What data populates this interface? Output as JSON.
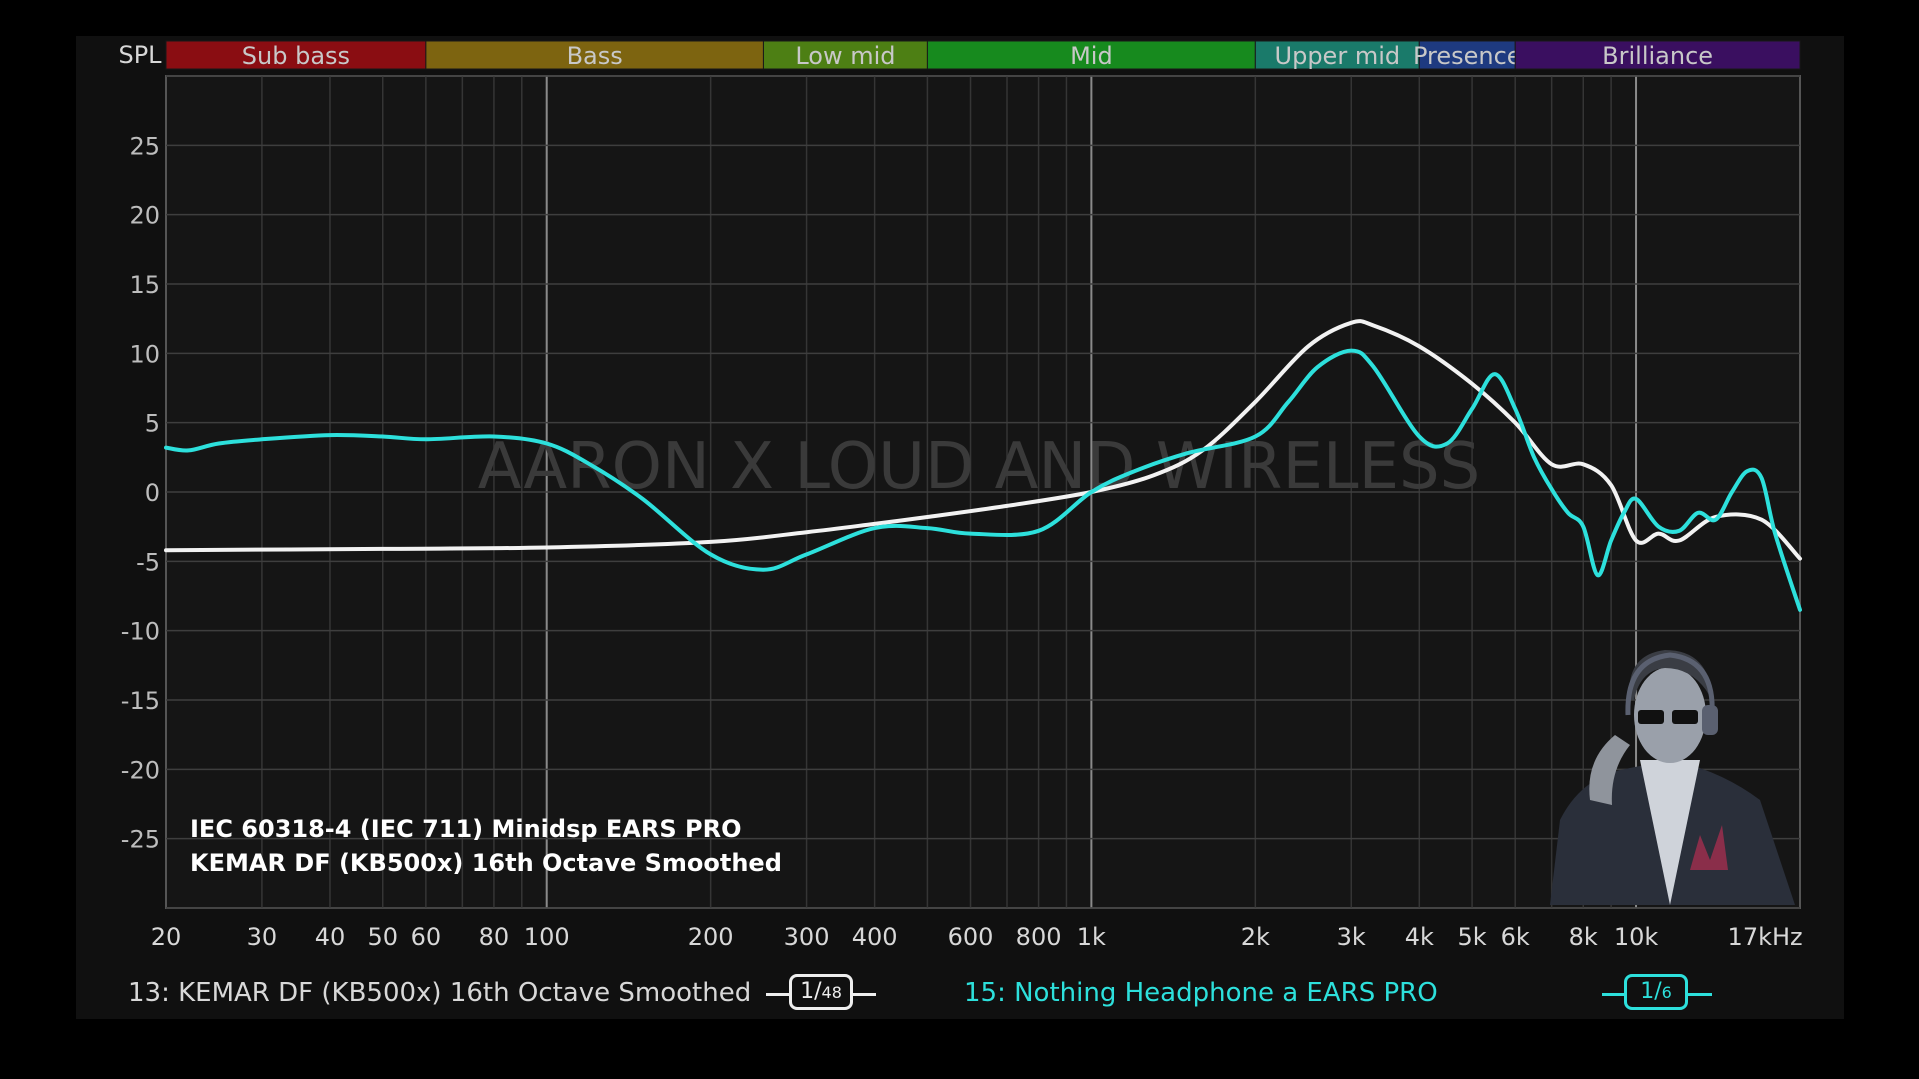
{
  "chart_data": {
    "type": "line",
    "title": "",
    "ylabel": "SPL",
    "xunit": "kHz",
    "x_scale": "log",
    "xlim": [
      20,
      20000
    ],
    "ylim": [
      -30,
      30
    ],
    "grid": true,
    "y_ticks": [
      25,
      20,
      15,
      10,
      5,
      0,
      -5,
      -10,
      -15,
      -20,
      -25
    ],
    "x_ticks": [
      {
        "value": 20,
        "label": "20"
      },
      {
        "value": 30,
        "label": "30"
      },
      {
        "value": 40,
        "label": "40"
      },
      {
        "value": 50,
        "label": "50"
      },
      {
        "value": 60,
        "label": "60"
      },
      {
        "value": 80,
        "label": "80"
      },
      {
        "value": 100,
        "label": "100"
      },
      {
        "value": 200,
        "label": "200"
      },
      {
        "value": 300,
        "label": "300"
      },
      {
        "value": 400,
        "label": "400"
      },
      {
        "value": 600,
        "label": "600"
      },
      {
        "value": 800,
        "label": "800"
      },
      {
        "value": 1000,
        "label": "1k"
      },
      {
        "value": 2000,
        "label": "2k"
      },
      {
        "value": 3000,
        "label": "3k"
      },
      {
        "value": 4000,
        "label": "4k"
      },
      {
        "value": 5000,
        "label": "5k"
      },
      {
        "value": 6000,
        "label": "6k"
      },
      {
        "value": 8000,
        "label": "8k"
      },
      {
        "value": 10000,
        "label": "10k"
      },
      {
        "value": 17000,
        "label": "17kHz"
      }
    ],
    "bands": [
      {
        "name": "Sub bass",
        "from": 20,
        "to": 60,
        "color": "#8a0d12"
      },
      {
        "name": "Bass",
        "from": 60,
        "to": 250,
        "color": "#7d6410"
      },
      {
        "name": "Low mid",
        "from": 250,
        "to": 500,
        "color": "#4d7f14"
      },
      {
        "name": "Mid",
        "from": 500,
        "to": 2000,
        "color": "#178a1e"
      },
      {
        "name": "Upper mid",
        "from": 2000,
        "to": 4000,
        "color": "#1a7a6a"
      },
      {
        "name": "Presence",
        "from": 4000,
        "to": 6000,
        "color": "#1e3a80"
      },
      {
        "name": "Brilliance",
        "from": 6000,
        "to": 20000,
        "color": "#3a0f60"
      }
    ],
    "series": [
      {
        "name": "13: KEMAR DF (KB500x) 16th Octave Smoothed",
        "color": "#f2f2f2",
        "smoothing": "1/48",
        "x": [
          20,
          50,
          100,
          200,
          300,
          400,
          500,
          700,
          1000,
          1300,
          1600,
          2000,
          2500,
          3000,
          3300,
          4000,
          5000,
          6000,
          7000,
          8000,
          9000,
          10000,
          11000,
          12000,
          14000,
          17000,
          20000
        ],
        "y": [
          -4.2,
          -4.1,
          -4.0,
          -3.6,
          -2.9,
          -2.3,
          -1.8,
          -1.0,
          0.0,
          1.2,
          3.0,
          6.5,
          10.5,
          12.2,
          12.0,
          10.5,
          7.8,
          5.0,
          2.0,
          2.0,
          0.5,
          -3.5,
          -3.0,
          -3.5,
          -1.8,
          -2.0,
          -4.8
        ]
      },
      {
        "name": "15: Nothing Headphone a EARS PRO",
        "color": "#2de0dc",
        "smoothing": "1/6",
        "x": [
          20,
          22,
          25,
          30,
          40,
          50,
          60,
          80,
          100,
          120,
          150,
          200,
          250,
          300,
          400,
          500,
          600,
          800,
          1000,
          1200,
          1500,
          2000,
          2300,
          2600,
          3000,
          3300,
          4000,
          4500,
          5000,
          5500,
          6000,
          6500,
          7000,
          7500,
          8000,
          8500,
          9000,
          9500,
          10000,
          11000,
          12000,
          13000,
          14000,
          15000,
          16000,
          17000,
          18000,
          20000
        ],
        "y": [
          3.2,
          3.0,
          3.5,
          3.8,
          4.1,
          4.0,
          3.8,
          4.0,
          3.5,
          2.0,
          -0.5,
          -4.5,
          -5.6,
          -4.5,
          -2.6,
          -2.6,
          -3.0,
          -2.8,
          0.0,
          1.5,
          2.8,
          4.0,
          6.5,
          9.0,
          10.2,
          9.0,
          4.0,
          3.5,
          6.0,
          8.5,
          6.0,
          2.5,
          0.2,
          -1.5,
          -2.5,
          -6.0,
          -3.5,
          -1.5,
          -0.5,
          -2.5,
          -2.8,
          -1.5,
          -2.0,
          0.0,
          1.5,
          1.0,
          -3.0,
          -8.5
        ]
      }
    ]
  },
  "watermark": "AARON X LOUD AND WIRELESS",
  "annotation": {
    "line1": "IEC 60318-4 (IEC 711) Minidsp EARS PRO",
    "line2": "KEMAR DF (KB500x) 16th Octave Smoothed"
  },
  "legend": {
    "series1_label": "13: KEMAR DF (KB500x) 16th Octave Smoothed",
    "series1_smoothing_num": "1",
    "series1_smoothing_den": "48",
    "series2_label": "15: Nothing Headphone a EARS PRO",
    "series2_smoothing_num": "1",
    "series2_smoothing_den": "6"
  },
  "colors": {
    "panel_bg": "#101010",
    "grid": "#444444",
    "text": "#d8d8d8",
    "series1": "#f2f2f2",
    "series2": "#2de0dc"
  },
  "icons": {
    "avatar": "person-with-headphones-avatar"
  }
}
